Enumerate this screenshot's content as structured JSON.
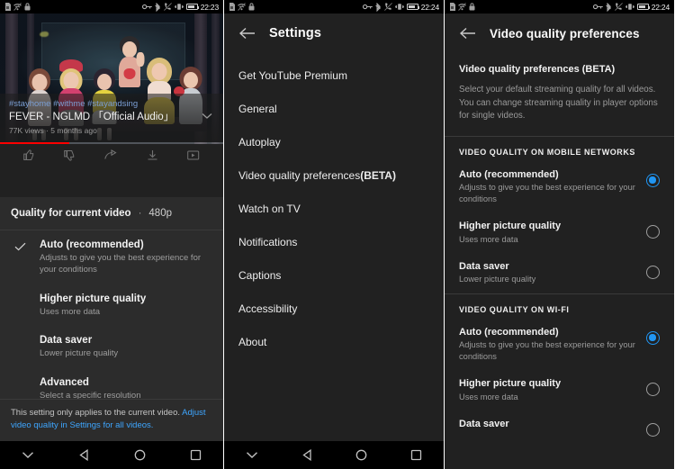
{
  "statusbar": {
    "icons_left": [
      "sim-card-icon",
      "wifi-off-icon",
      "lock-icon"
    ],
    "icons_right": [
      "vpn-key-icon",
      "bluetooth-icon",
      "call-mute-icon",
      "vibrate-icon"
    ],
    "time_left_panel": "22:23",
    "time_mid_panel": "22:24",
    "time_right_panel": "22:24"
  },
  "player": {
    "hashtags": "#stayhome #withme #stayandsing",
    "title": "FEVER - NGLMD 「Official Audio」",
    "stats": "77K views · 5 months ago",
    "collapse_icon": "chevron-down-icon",
    "progress_percent": 31,
    "progress_color": "#ff0000",
    "actions": [
      "thumb-up-icon",
      "thumb-down-icon",
      "share-icon",
      "download-icon",
      "save-to-playlist-icon"
    ]
  },
  "quality_sheet": {
    "heading": "Quality for current video",
    "separator": "·",
    "current_value": "480p",
    "check_icon": "check-icon",
    "options": [
      {
        "title": "Auto (recommended)",
        "subtitle": "Adjusts to give you the best experience for your conditions",
        "selected": true
      },
      {
        "title": "Higher picture quality",
        "subtitle": "Uses more data",
        "selected": false
      },
      {
        "title": "Data saver",
        "subtitle": "Lower picture quality",
        "selected": false
      },
      {
        "title": "Advanced",
        "subtitle": "Select a specific resolution",
        "selected": false
      }
    ],
    "footer_text": "This setting only applies to the current video. ",
    "footer_link": "Adjust video quality in Settings for all videos."
  },
  "settings": {
    "back_icon": "arrow-back-icon",
    "title": "Settings",
    "items": [
      {
        "label": "Get YouTube Premium"
      },
      {
        "label": "General"
      },
      {
        "label": "Autoplay"
      },
      {
        "label": "Video quality preferences ",
        "badge": "(BETA)"
      },
      {
        "label": "Watch on TV"
      },
      {
        "label": "Notifications"
      },
      {
        "label": "Captions"
      },
      {
        "label": "Accessibility"
      },
      {
        "label": "About"
      }
    ]
  },
  "prefs": {
    "back_icon": "arrow-back-icon",
    "title": "Video quality preferences",
    "heading": "Video quality preferences ",
    "heading_badge": "(BETA)",
    "description": "Select your default streaming quality for all videos. You can change streaming quality in player options for single videos.",
    "accent_color": "#2196f3",
    "sections": [
      {
        "title": "VIDEO QUALITY ON MOBILE NETWORKS",
        "options": [
          {
            "title": "Auto (recommended)",
            "subtitle": "Adjusts to give you the best experience for your conditions",
            "selected": true
          },
          {
            "title": "Higher picture quality",
            "subtitle": "Uses more data",
            "selected": false
          },
          {
            "title": "Data saver",
            "subtitle": "Lower picture quality",
            "selected": false
          }
        ]
      },
      {
        "title": "VIDEO QUALITY ON WI-FI",
        "options": [
          {
            "title": "Auto (recommended)",
            "subtitle": "Adjusts to give you the best experience for your conditions",
            "selected": true
          },
          {
            "title": "Higher picture quality",
            "subtitle": "Uses more data",
            "selected": false
          },
          {
            "title": "Data saver",
            "subtitle": "",
            "selected": false
          }
        ]
      }
    ]
  },
  "navbar": {
    "buttons": [
      "chevron-down-icon",
      "back-triangle-icon",
      "home-circle-icon",
      "recents-square-icon"
    ]
  }
}
